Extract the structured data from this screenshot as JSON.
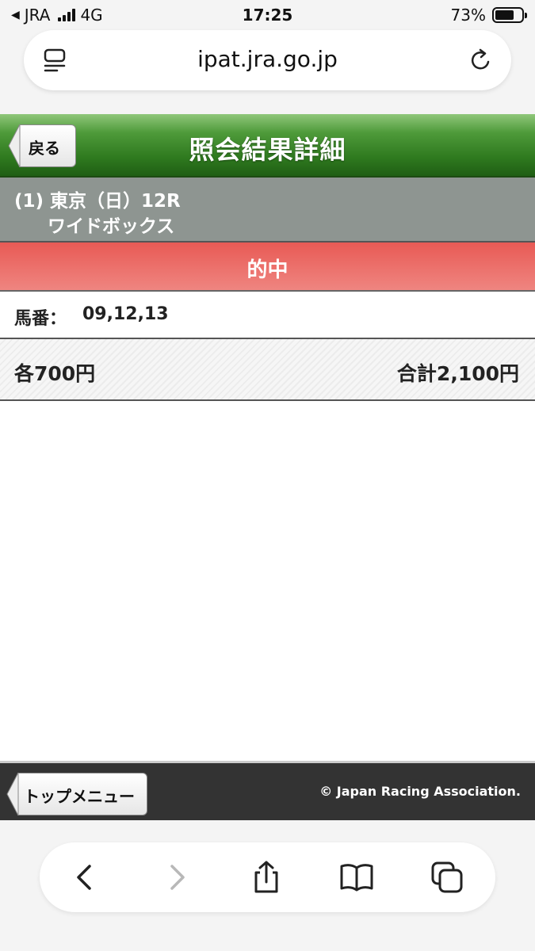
{
  "status": {
    "carrier": "JRA",
    "network": "4G",
    "time": "17:25",
    "battery": "73%",
    "battery_level": 0.73
  },
  "browser": {
    "url": "ipat.jra.go.jp"
  },
  "header": {
    "back_label": "戻る",
    "title": "照会結果詳細"
  },
  "race": {
    "line1": "(1) 東京（日）12R",
    "line2": "ワイドボックス"
  },
  "result": {
    "hit": "的中"
  },
  "numbers": {
    "label": "馬番：",
    "value": "09,12,13"
  },
  "amounts": {
    "each": "各700円",
    "total": "合計2,100円"
  },
  "footer": {
    "top_menu_label": "トップメニュー",
    "copyright": "© Japan Racing Association."
  },
  "colors": {
    "header_green": "#2f7a1f",
    "hit_red": "#e85a55",
    "race_gray": "#8e9591",
    "footer_dark": "#333333"
  }
}
